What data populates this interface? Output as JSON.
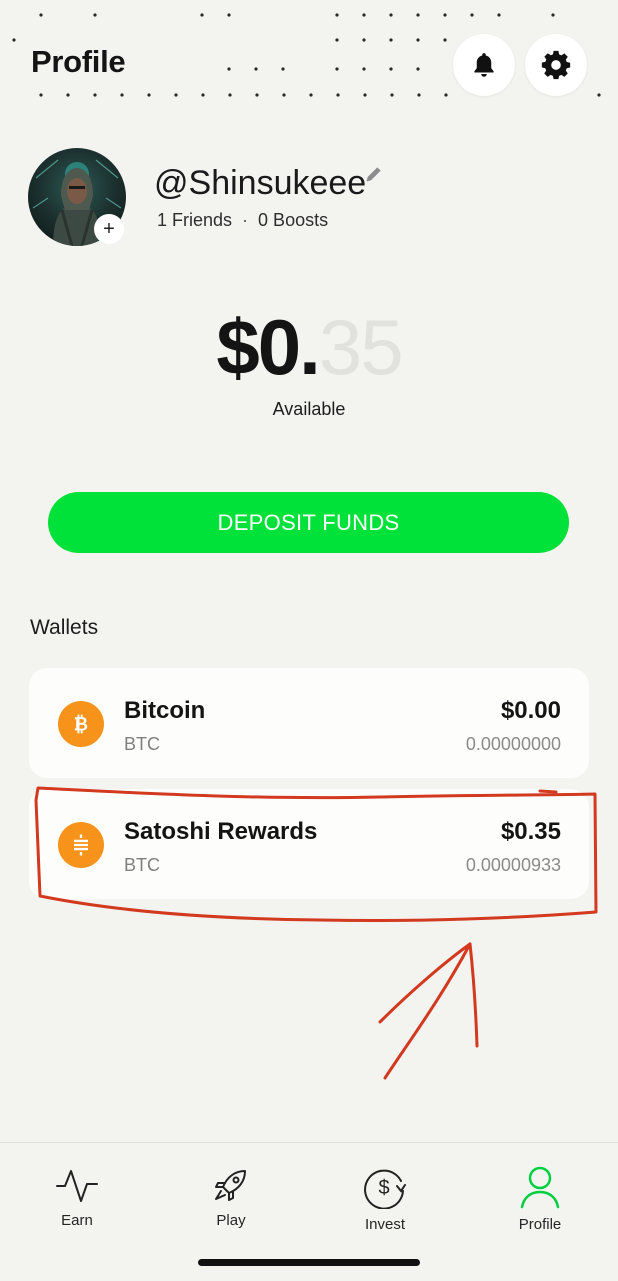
{
  "header": {
    "title": "Profile",
    "notifications_icon": "bell-icon",
    "settings_icon": "gear-icon"
  },
  "profile": {
    "username": "@Shinsukeee",
    "friends": "1 Friends",
    "separator": "·",
    "boosts": "0 Boosts",
    "avatar_add": "+",
    "edit_icon": "pencil-icon"
  },
  "balance": {
    "dollars": "$0.",
    "cents": "35",
    "label": "Available"
  },
  "deposit_button": "DEPOSIT FUNDS",
  "wallets": {
    "title": "Wallets",
    "items": [
      {
        "name": "Bitcoin",
        "ticker": "BTC",
        "usd": "$0.00",
        "btc": "0.00000000",
        "icon": "bitcoin-icon"
      },
      {
        "name": "Satoshi Rewards",
        "ticker": "BTC",
        "usd": "$0.35",
        "btc": "0.00000933",
        "icon": "satoshi-icon"
      }
    ]
  },
  "nav": {
    "items": [
      {
        "label": "Earn",
        "icon": "activity-icon"
      },
      {
        "label": "Play",
        "icon": "rocket-icon"
      },
      {
        "label": "Invest",
        "icon": "dollar-cycle-icon"
      },
      {
        "label": "Profile",
        "icon": "user-icon",
        "active": true
      }
    ]
  },
  "colors": {
    "background": "#f3f4ef",
    "accent_green": "#00e13a",
    "coin_orange": "#f7931a",
    "annotation_red": "#d2391f"
  }
}
